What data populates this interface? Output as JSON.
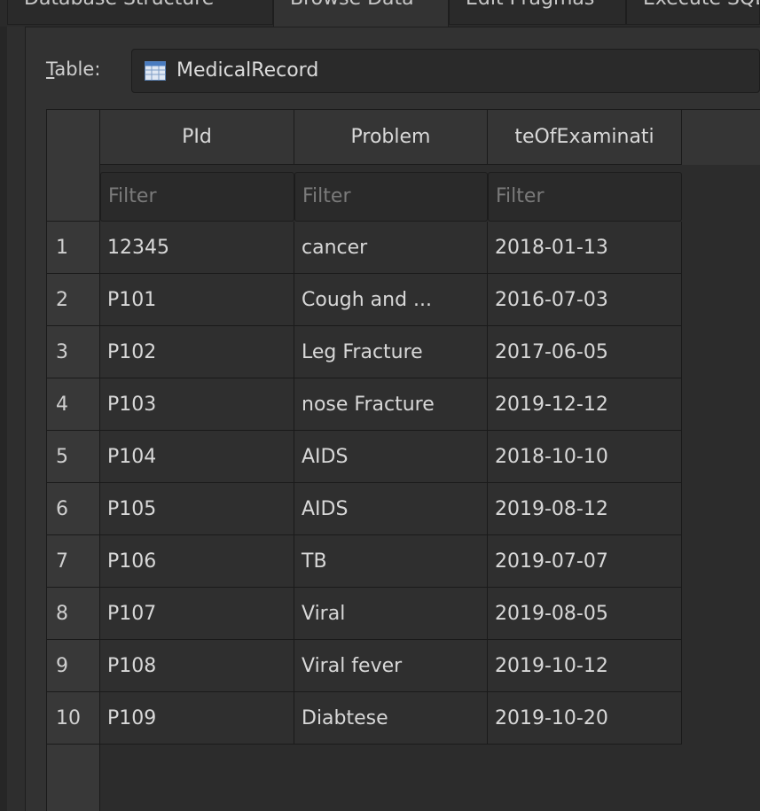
{
  "tabs": [
    {
      "label": "Database Structure"
    },
    {
      "label": "Browse Data"
    },
    {
      "label": "Edit Pragmas"
    },
    {
      "label": "Execute SQL"
    }
  ],
  "table_selector": {
    "label": "Table:",
    "label_mnemonic": "T",
    "label_rest": "able:",
    "value": "MedicalRecord",
    "icon": "table-icon"
  },
  "grid": {
    "columns": [
      "PId",
      "Problem",
      "teOfExaminati"
    ],
    "filter_placeholder": "Filter",
    "rows": [
      {
        "n": "1",
        "pid": "12345",
        "problem": "cancer",
        "date": "2018-01-13"
      },
      {
        "n": "2",
        "pid": "P101",
        "problem": "Cough and ...",
        "date": "2016-07-03"
      },
      {
        "n": "3",
        "pid": "P102",
        "problem": "Leg Fracture",
        "date": "2017-06-05"
      },
      {
        "n": "4",
        "pid": "P103",
        "problem": "nose Fracture",
        "date": "2019-12-12"
      },
      {
        "n": "5",
        "pid": "P104",
        "problem": "AIDS",
        "date": "2018-10-10"
      },
      {
        "n": "6",
        "pid": "P105",
        "problem": "AIDS",
        "date": "2019-08-12"
      },
      {
        "n": "7",
        "pid": "P106",
        "problem": "TB",
        "date": "2019-07-07"
      },
      {
        "n": "8",
        "pid": "P107",
        "problem": "Viral",
        "date": "2019-08-05"
      },
      {
        "n": "9",
        "pid": "P108",
        "problem": "Viral fever",
        "date": "2019-10-12"
      },
      {
        "n": "10",
        "pid": "P109",
        "problem": "Diabtese",
        "date": "2019-10-20"
      }
    ]
  }
}
